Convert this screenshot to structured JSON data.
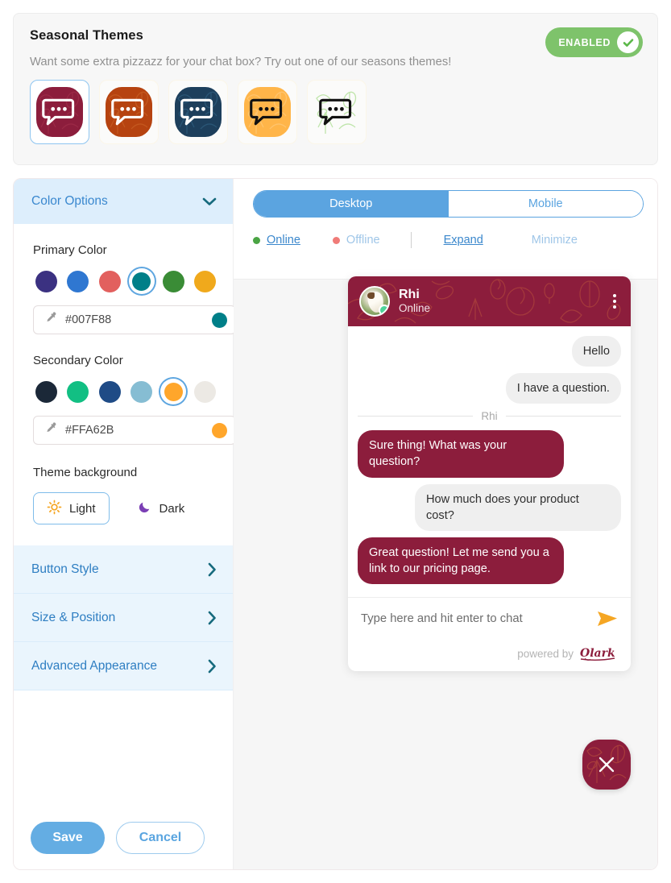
{
  "seasonal": {
    "title": "Seasonal Themes",
    "subtitle": "Want some extra pizzazz for your chat box? Try out one of our seasons themes!",
    "badge_label": "ENABLED",
    "badge_color": "#7ec36b",
    "themes": [
      {
        "name": "maroon-autumn-theme",
        "color": "#8c1d3c",
        "pattern": "#a8344f",
        "icon_color": "#ffffff",
        "selected": true
      },
      {
        "name": "rust-autumn-theme",
        "color": "#b64310",
        "pattern": "#cf6a2c",
        "icon_color": "#ffffff",
        "selected": false
      },
      {
        "name": "navy-winter-theme",
        "color": "#1d3f5c",
        "pattern": "#356a8c",
        "icon_color": "#ffffff",
        "selected": false
      },
      {
        "name": "amber-fall-theme",
        "color": "#ffb549",
        "pattern": "#ffd08a",
        "icon_color": "#111111",
        "selected": false
      },
      {
        "name": "green-spring-theme",
        "color": "#77c council",
        "pattern": "#8fd46a",
        "icon_color": "#111111",
        "selected": false
      }
    ]
  },
  "sidebar": {
    "sections": [
      {
        "label": "Color Options",
        "expanded": true
      },
      {
        "label": "Button Style",
        "expanded": false
      },
      {
        "label": "Size & Position",
        "expanded": false
      },
      {
        "label": "Advanced Appearance",
        "expanded": false
      }
    ],
    "primary": {
      "label": "Primary Color",
      "hex": "#007F88",
      "swatches": [
        "#3b3181",
        "#2f77d1",
        "#e2605e",
        "#007f88",
        "#3a8c36",
        "#f0a91c"
      ],
      "selected_index": 3
    },
    "secondary": {
      "label": "Secondary Color",
      "hex": "#FFA62B",
      "swatches": [
        "#1b2838",
        "#12bf83",
        "#1f4b86",
        "#86bdd3",
        "#ffa62b",
        "#ece9e4"
      ],
      "selected_index": 4
    },
    "theme_background": {
      "label": "Theme background",
      "options": [
        {
          "label": "Light",
          "icon": "sun-icon",
          "active": true
        },
        {
          "label": "Dark",
          "icon": "moon-icon",
          "active": false
        }
      ]
    }
  },
  "preview": {
    "device_tabs": [
      {
        "label": "Desktop",
        "active": true
      },
      {
        "label": "Mobile",
        "active": false
      }
    ],
    "status_links": [
      {
        "label": "Online",
        "dot": "#4aa444",
        "active": true
      },
      {
        "label": "Offline",
        "dot": "#f07b78",
        "active": false
      }
    ],
    "view_links": [
      {
        "label": "Expand",
        "active": true
      },
      {
        "label": "Minimize",
        "active": false
      }
    ]
  },
  "chat": {
    "agent_name": "Rhi",
    "agent_status": "Online",
    "divider_name": "Rhi",
    "messages": [
      {
        "from": "visitor",
        "text": "Hello"
      },
      {
        "from": "visitor",
        "text": "I have a question."
      },
      {
        "from": "agent",
        "text": "Sure thing! What was your question?"
      },
      {
        "from": "visitor",
        "text": "How much does your product cost?"
      },
      {
        "from": "agent",
        "text": "Great question! Let me send you a link to our pricing page."
      }
    ],
    "input_placeholder": "Type here and hit enter to chat",
    "powered_by": "powered by",
    "brand": "Olark",
    "header_color": "#8c1d3c"
  },
  "footer": {
    "save_label": "Save",
    "cancel_label": "Cancel"
  }
}
